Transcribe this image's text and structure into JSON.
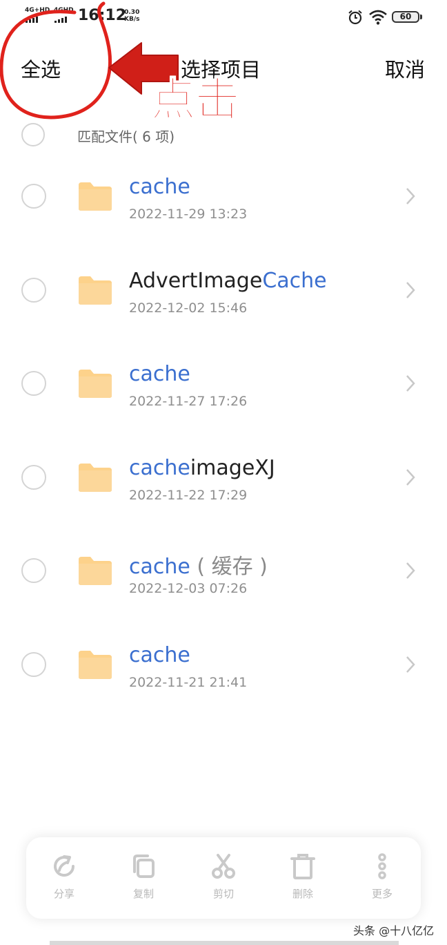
{
  "status_bar": {
    "network_1": "4G+HD",
    "network_2": "4GHD",
    "time": "16:12",
    "speed_value": "0.30",
    "speed_unit": "KB/s",
    "battery": "60"
  },
  "header": {
    "select_all": "全选",
    "title": "选择项目",
    "cancel": "取消"
  },
  "annotation": {
    "text": "点击",
    "color": "#e0221c"
  },
  "summary": "匹配文件( 6 项)",
  "files": [
    {
      "highlight": "cache",
      "rest": "",
      "note": "",
      "date": "2022-11-29 13:23"
    },
    {
      "highlight": "",
      "rest": "AdvertImage",
      "note": "",
      "suffix_highlight": "Cache",
      "date": "2022-12-02 15:46"
    },
    {
      "highlight": "cache",
      "rest": "",
      "note": "",
      "date": "2022-11-27 17:26"
    },
    {
      "highlight": "cache",
      "rest": "imageXJ",
      "note": "",
      "date": "2022-11-22 17:29"
    },
    {
      "highlight": "cache",
      "rest": "",
      "note": " ( 缓存 )",
      "date": "2022-12-03 07:26"
    },
    {
      "highlight": "cache",
      "rest": "",
      "note": "",
      "date": "2022-11-21 21:41"
    }
  ],
  "actions": [
    {
      "label": "分享",
      "icon": "share-icon"
    },
    {
      "label": "复制",
      "icon": "copy-icon"
    },
    {
      "label": "剪切",
      "icon": "cut-icon"
    },
    {
      "label": "删除",
      "icon": "delete-icon"
    },
    {
      "label": "更多",
      "icon": "more-icon"
    }
  ],
  "watermark": "头条 @十八亿亿",
  "colors": {
    "highlight": "#3b6fcf",
    "folder": "#fdd28b",
    "annotation": "#e0221c"
  }
}
